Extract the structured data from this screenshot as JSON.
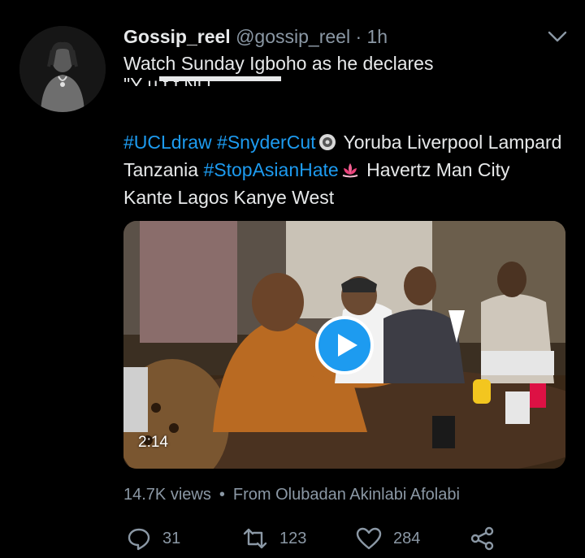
{
  "tweet": {
    "author_name": "Gossip_reel",
    "author_handle": "@gossip_reel",
    "separator": "·",
    "time": "1h",
    "text_line1": "Watch Sunday Igboho as he declares",
    "text_line2_fragment": "\"Y          u                   t    f Ni     i",
    "tags": {
      "h1": "#UCLdraw",
      "h2": "#SnyderCut",
      "t1": " Yoruba Liverpool Lampard Tanzania ",
      "h3": "#StopAsianHate",
      "t2": " Havertz Man City Kante Lagos Kanye West"
    }
  },
  "video": {
    "duration": "2:14",
    "play_icon": "play-icon"
  },
  "meta": {
    "views": "14.7K views",
    "bullet": "•",
    "source": "From Olubadan Akinlabi Afolabi"
  },
  "actions": {
    "replies": "31",
    "retweets": "123",
    "likes": "284"
  },
  "colors": {
    "background": "#000000",
    "text": "#e7e9ea",
    "secondary": "#8b98a5",
    "link": "#1d9bf0",
    "play": "#1d9bf0"
  }
}
